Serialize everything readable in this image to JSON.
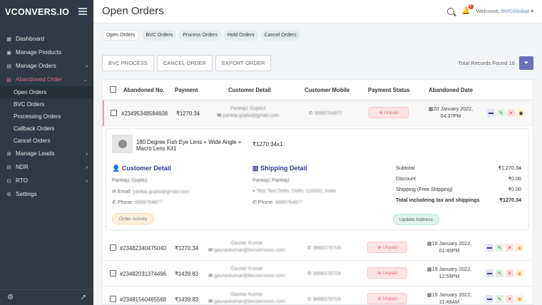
{
  "brand": {
    "logo_text": "VCONVERS.IO"
  },
  "sidebar": {
    "items": [
      {
        "label": "Dashboard",
        "icon": "dashboard-icon",
        "chevron": false
      },
      {
        "label": "Manage Products",
        "icon": "box-icon",
        "chevron": false
      },
      {
        "label": "Manage Orders",
        "icon": "cart-icon",
        "chevron": true
      },
      {
        "label": "Abandoned Order",
        "icon": "bag-icon",
        "chevron": true,
        "active": true
      }
    ],
    "sub_items": [
      "Open Orders",
      "BVC Orders",
      "Processing Orders",
      "Callback Orders",
      "Cancel Orders"
    ],
    "items_after": [
      {
        "label": "Manage Leads",
        "icon": "leads-icon",
        "chevron": true
      },
      {
        "label": "NDR",
        "icon": "ndr-icon",
        "chevron": true
      },
      {
        "label": "RTO",
        "icon": "rto-icon",
        "chevron": true
      },
      {
        "label": "Settings",
        "icon": "gear-icon",
        "chevron": false
      }
    ]
  },
  "header": {
    "title": "Open Orders",
    "notification_count": "0",
    "welcome_prefix": "Welcome,",
    "user_name": "BVCGlobal"
  },
  "tabs": [
    "Open Orders",
    "BVC Orders",
    "Process Orders",
    "Hold Orders",
    "Cancel Orders"
  ],
  "actions": {
    "bvc_process": "BVC PROCESS",
    "cancel_order": "CANCEL ORDER",
    "export_order": "EXPORT ORDER"
  },
  "records_text": "Total Records Found 16",
  "table": {
    "columns": [
      "Abandoned No.",
      "Payment",
      "Customer Detail",
      "Customer Mobile",
      "Payment Status",
      "Abandoned Date"
    ],
    "rows": [
      {
        "id": "#23495348584608",
        "payment": "₹1270.34",
        "customer_name": "Pankaj1 Gupta1",
        "customer_email": "pankaj.gupta@gmail.com",
        "mobile": "9999764877",
        "status": "Unpaid",
        "date": "20 January 2022,",
        "time": "04:37PM"
      },
      {
        "id": "#23482340475040",
        "payment": "₹1270.34",
        "customer_name": "Gaurav Kumar",
        "customer_email": "gauravkumar@bvcservices.com",
        "mobile": "9868378709",
        "status": "Unpaid",
        "date": "19 January 2022,",
        "time": "01:45PM"
      },
      {
        "id": "#23482031374496",
        "payment": "₹1439.83",
        "customer_name": "Gaurav Kumar",
        "customer_email": "gauravkumar@bvcservices.com",
        "mobile": "9868378709",
        "status": "Unpaid",
        "date": "19 January 2022,",
        "time": "12:59PM"
      },
      {
        "id": "#23481560465568",
        "payment": "₹1439.83",
        "customer_name": "Gaurav Kumar",
        "customer_email": "gauravkumar@bvcservices.com",
        "mobile": "9868378709",
        "status": "Unpaid",
        "date": "19 January 2022,",
        "time": "11:49AM"
      }
    ]
  },
  "detail": {
    "product_name": "180 Degree Fish Eye Lens + Wide Angle + Macro Lens Kit1",
    "product_price": "₹1270.34x1",
    "customer_title": "Customer Detail",
    "customer_name": "Pankaj1 Gupta1",
    "email_label": "Email:",
    "email_value": "pankaj.gupta@gmail.com",
    "phone_label": "Phone:",
    "phone_value": "9999764877",
    "shipping_title": "Shipping Detail",
    "shipping_name": "Pankaj1 Pankaj1",
    "shipping_address": "Test Test Delhi, Delhi, 110092, India",
    "shipping_phone_label": "Phone:",
    "shipping_phone_value": "9999764877",
    "order_activity": "Order Activity",
    "update_address": "Update Address",
    "summary": [
      {
        "label": "Subtotal",
        "value": "₹1,270.34"
      },
      {
        "label": "Discount",
        "value": "₹0.00"
      },
      {
        "label": "Shipping (Free Shipping)",
        "value": "₹0.00"
      },
      {
        "label": "Total includeing tax and shippings",
        "value": "₹1270.34"
      }
    ]
  }
}
